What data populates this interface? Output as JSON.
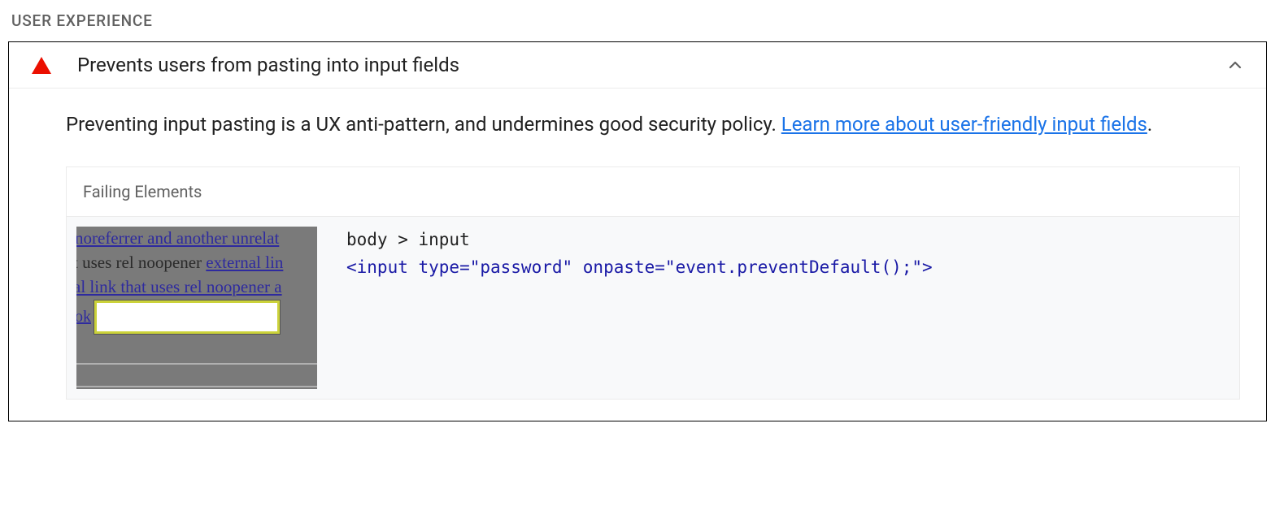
{
  "section": {
    "title": "USER EXPERIENCE"
  },
  "audit": {
    "title": "Prevents users from pasting into input fields",
    "description": "Preventing input pasting is a UX anti-pattern, and undermines good security policy. ",
    "learn_more": "Learn more about user-friendly input fields",
    "description_suffix": "."
  },
  "failing": {
    "header": "Failing Elements",
    "element_path": "body > input",
    "element_snippet": "<input type=\"password\" onpaste=\"event.preventDefault();\">"
  },
  "thumbnail": {
    "line1_link": " noreferrer and another unrelat",
    "line2_prefix": "t uses rel noopener ",
    "line2_link": "external lin",
    "line3_link": "al link that uses rel noopener a",
    "line4_ok": " ok"
  }
}
